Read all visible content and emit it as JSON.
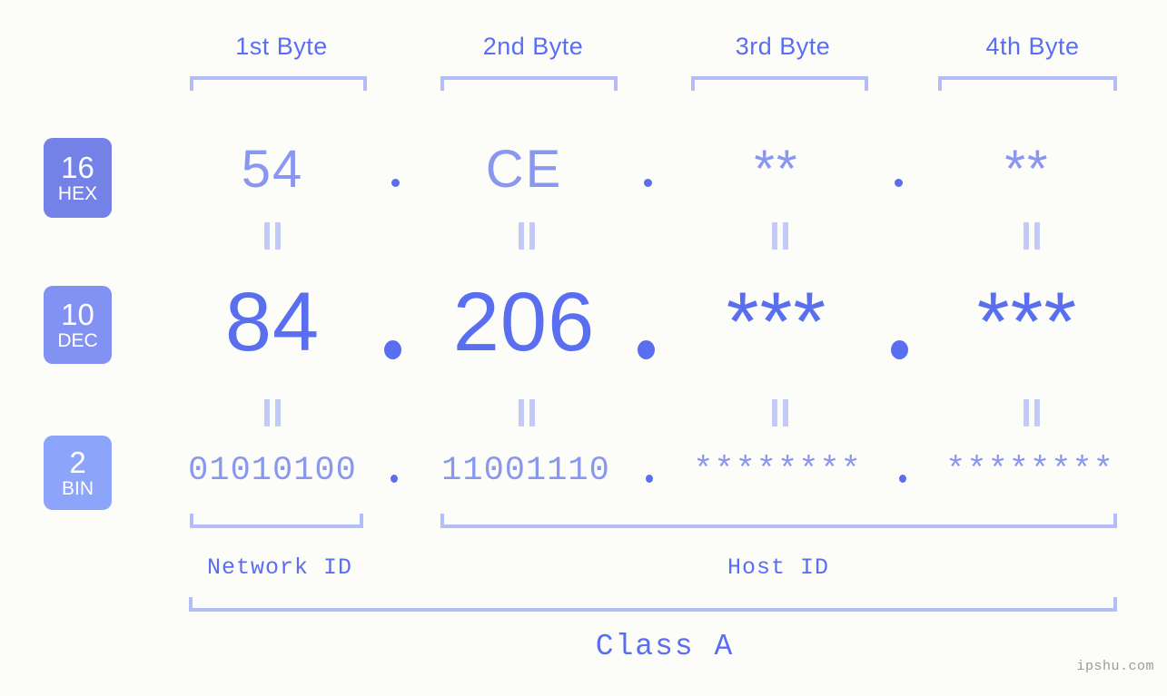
{
  "meta": {
    "watermark": "ipshu.com"
  },
  "byte_headers": [
    {
      "label": "1st Byte"
    },
    {
      "label": "2nd Byte"
    },
    {
      "label": "3rd Byte"
    },
    {
      "label": "4th Byte"
    }
  ],
  "rows": [
    {
      "key": "hex",
      "badge": {
        "base": "16",
        "name": "HEX",
        "color": "#7482e8"
      },
      "values": [
        "54",
        "CE",
        "**",
        "**"
      ],
      "separator": "."
    },
    {
      "key": "dec",
      "badge": {
        "base": "10",
        "name": "DEC",
        "color": "#8292f2"
      },
      "values": [
        "84",
        "206",
        "***",
        "***"
      ],
      "separator": "."
    },
    {
      "key": "bin",
      "badge": {
        "base": "2",
        "name": "BIN",
        "color": "#8da4fb"
      },
      "values": [
        "01010100",
        "11001110",
        "********",
        "********"
      ],
      "separator": "."
    }
  ],
  "equality_marks": {
    "symbol": "=",
    "count_upper": 4,
    "count_lower": 4
  },
  "segments": {
    "network_id": "Network ID",
    "host_id": "Host ID",
    "class": "Class A"
  },
  "colors": {
    "background": "#fcfdf8",
    "accent_strong": "#5a6ef0",
    "accent_mid": "#8a97ef",
    "accent_light": "#b3bdf7",
    "title": "#5b6ef2",
    "watermark": "#9a9a9a"
  }
}
